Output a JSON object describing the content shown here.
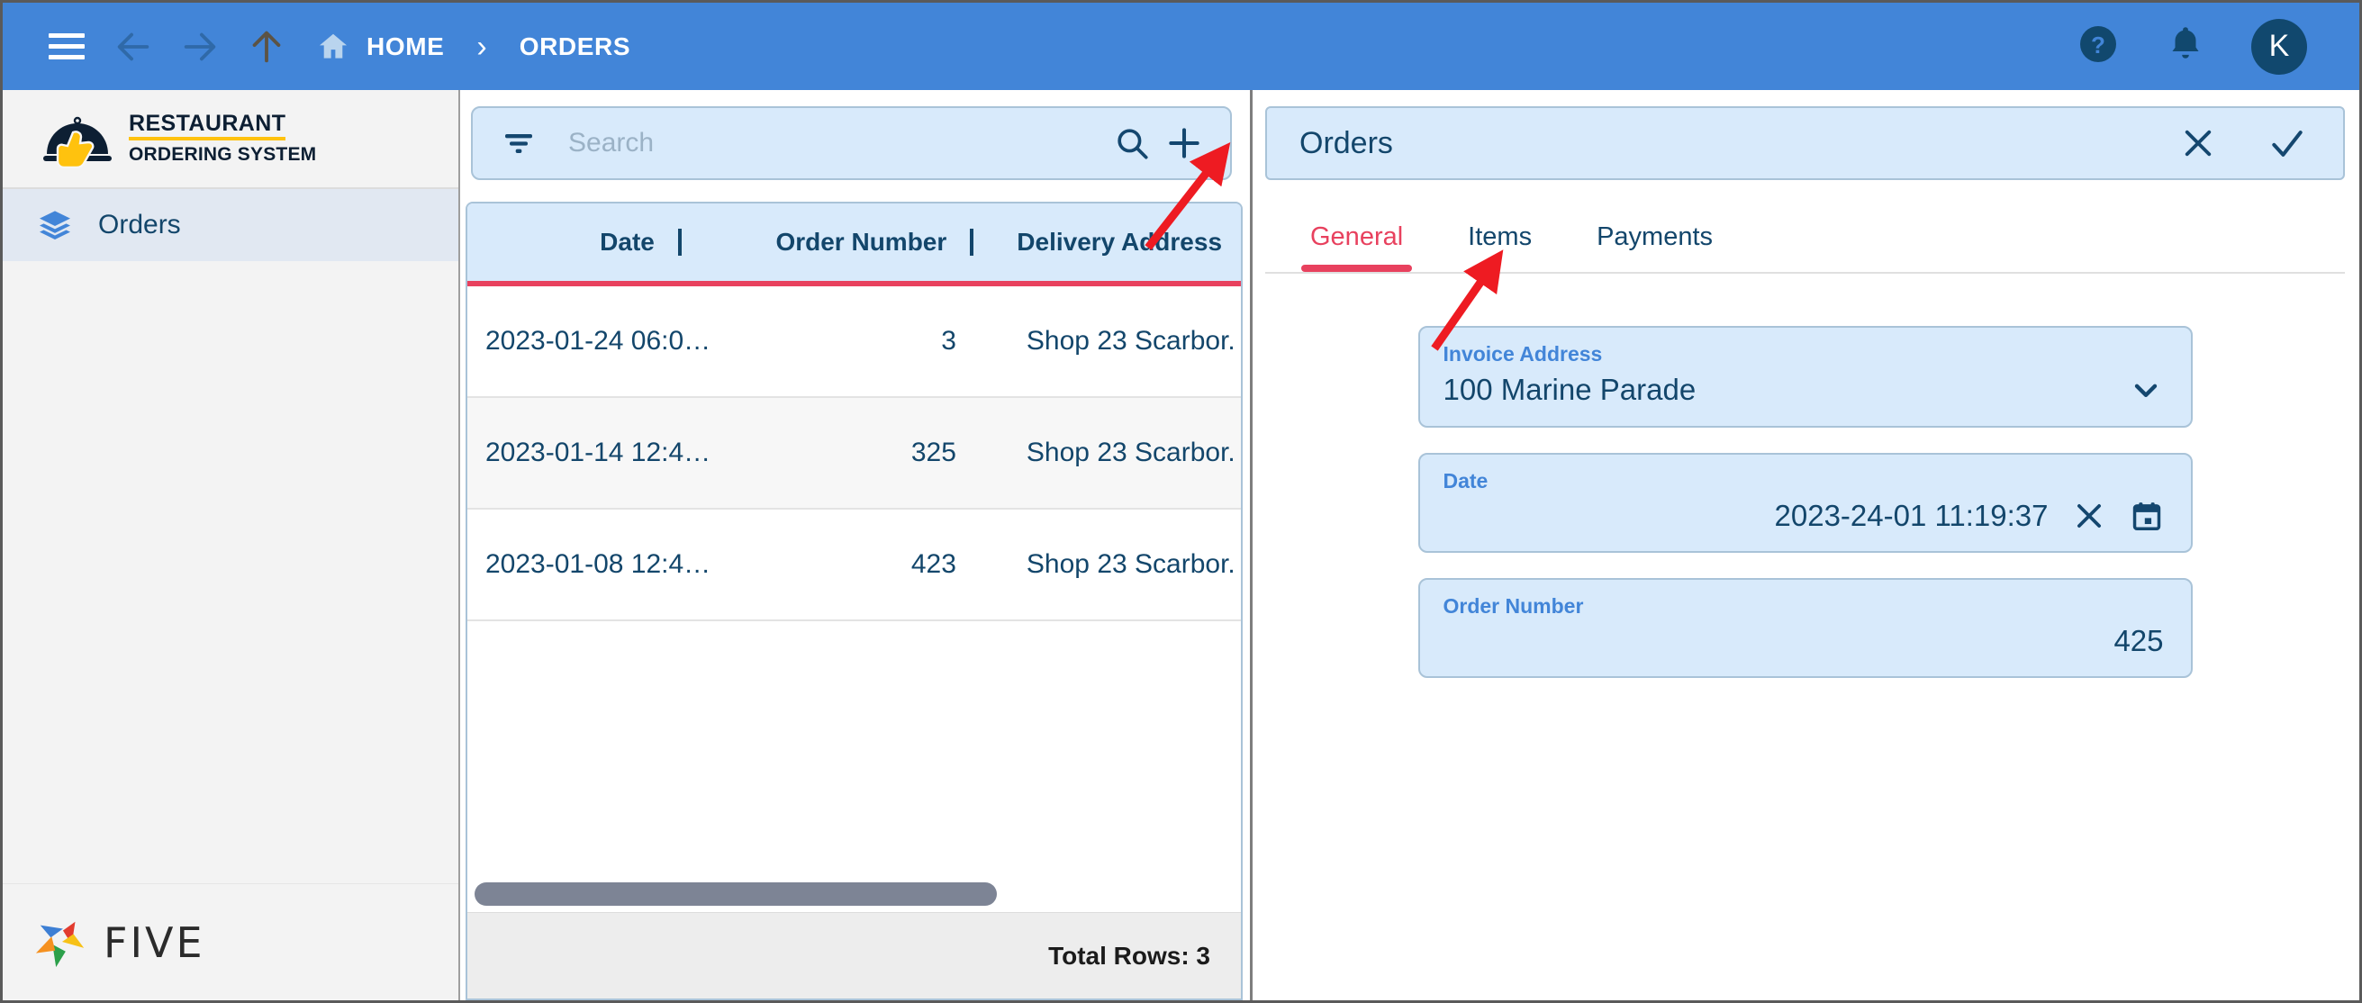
{
  "topbar": {
    "menu_icon": "hamburger-icon",
    "back_icon": "arrow-left-icon",
    "forward_icon": "arrow-right-icon",
    "up_icon": "arrow-up-icon",
    "home_icon": "home-icon",
    "breadcrumb": {
      "home": "HOME",
      "separator": "›",
      "current": "ORDERS"
    },
    "help_icon": "help-circle-icon",
    "bell_icon": "bell-icon",
    "avatar_initial": "K",
    "bg_color": "#4285d8",
    "avatar_color": "#11486e"
  },
  "sidebar": {
    "brand": {
      "line1": "RESTAURANT",
      "line2": "ORDERING SYSTEM",
      "accent": "#ffc20e"
    },
    "items": [
      {
        "label": "Orders",
        "icon": "layers-icon",
        "selected": true
      }
    ],
    "footer": {
      "word": "FIVE",
      "logo": "five-pinwheel-logo"
    }
  },
  "list_panel": {
    "search": {
      "filter_icon": "filter-icon",
      "placeholder": "Search",
      "value": "",
      "search_icon": "search-icon",
      "add_icon": "plus-icon"
    },
    "columns": [
      "Date",
      "Order Number",
      "Delivery Address"
    ],
    "column_divider": "|",
    "rows": [
      {
        "date": "2023-01-24 06:0…",
        "order_number": "3",
        "delivery_address": "Shop 23 Scarbor."
      },
      {
        "date": "2023-01-14 12:4…",
        "order_number": "325",
        "delivery_address": "Shop 23 Scarbor."
      },
      {
        "date": "2023-01-08 12:4…",
        "order_number": "423",
        "delivery_address": "Shop 23 Scarbor."
      }
    ],
    "footer": {
      "total_rows": "Total Rows: 3"
    },
    "header_underline_color": "#e8415e"
  },
  "detail_panel": {
    "title": "Orders",
    "close_icon": "close-icon",
    "confirm_icon": "check-icon",
    "tabs": [
      {
        "label": "General",
        "active": true
      },
      {
        "label": "Items",
        "active": false
      },
      {
        "label": "Payments",
        "active": false
      }
    ],
    "active_tab_color": "#e8415e",
    "fields": [
      {
        "label": "Invoice Address",
        "value": "100 Marine Parade",
        "align": "left",
        "icons": [
          "chevron-down-icon"
        ]
      },
      {
        "label": "Date",
        "value": "2023-24-01 11:19:37",
        "align": "right",
        "icons": [
          "clear-x-icon",
          "calendar-icon"
        ]
      },
      {
        "label": "Order Number",
        "value": "425",
        "align": "right",
        "icons": []
      }
    ]
  },
  "annotations": [
    {
      "name": "arrow-to-add-button",
      "color": "#ee1b22",
      "target": "plus-icon"
    },
    {
      "name": "arrow-to-items-tab",
      "color": "#ee1b22",
      "target": "tab-items"
    }
  ]
}
